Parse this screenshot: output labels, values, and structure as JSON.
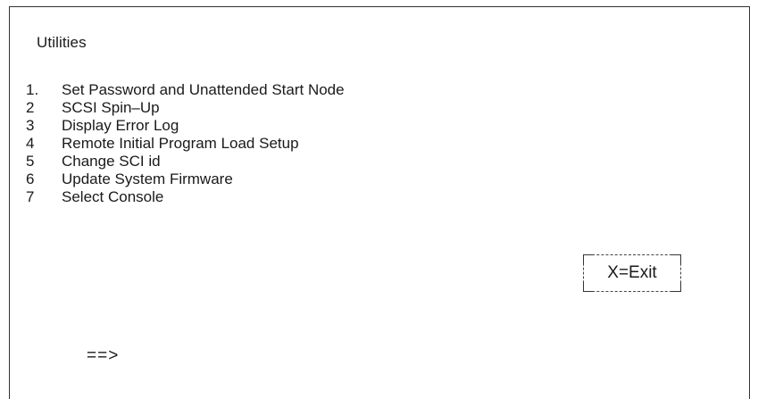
{
  "screen": {
    "title": "Utilities"
  },
  "menu": {
    "items": [
      {
        "number": "1.",
        "label": "Set Password and Unattended Start Node"
      },
      {
        "number": "2",
        "label": "SCSI Spin–Up"
      },
      {
        "number": "3",
        "label": "Display Error Log"
      },
      {
        "number": "4",
        "label": "Remote Initial Program Load Setup"
      },
      {
        "number": "5",
        "label": "Change SCI id"
      },
      {
        "number": "6",
        "label": "Update System Firmware"
      },
      {
        "number": "7",
        "label": "Select Console"
      }
    ]
  },
  "exit": {
    "label": "X=Exit"
  },
  "prompt": {
    "symbol": "==>",
    "value": ""
  }
}
